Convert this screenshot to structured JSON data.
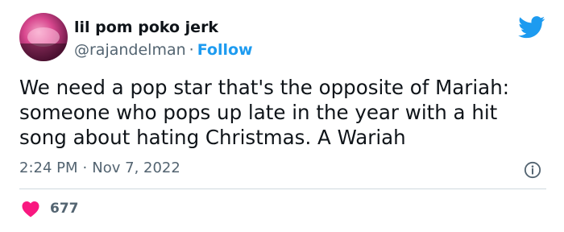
{
  "author": {
    "display_name": "lil pom poko jerk",
    "handle": "@rajandelman",
    "separator": "·",
    "follow_label": "Follow"
  },
  "tweet": {
    "text": "We need a pop star that's the opposite of Mariah: someone who pops up late in the year with a hit song about hating Christmas. A Wariah",
    "time": "2:24 PM",
    "date_separator": "·",
    "date": "Nov 7, 2022"
  },
  "engagement": {
    "likes": "677"
  },
  "icons": {
    "brand": "twitter-bird-icon",
    "info": "info-icon",
    "like": "heart-icon"
  },
  "colors": {
    "accent": "#1d9bf0",
    "heart": "#f91880",
    "secondary_text": "#536471"
  }
}
